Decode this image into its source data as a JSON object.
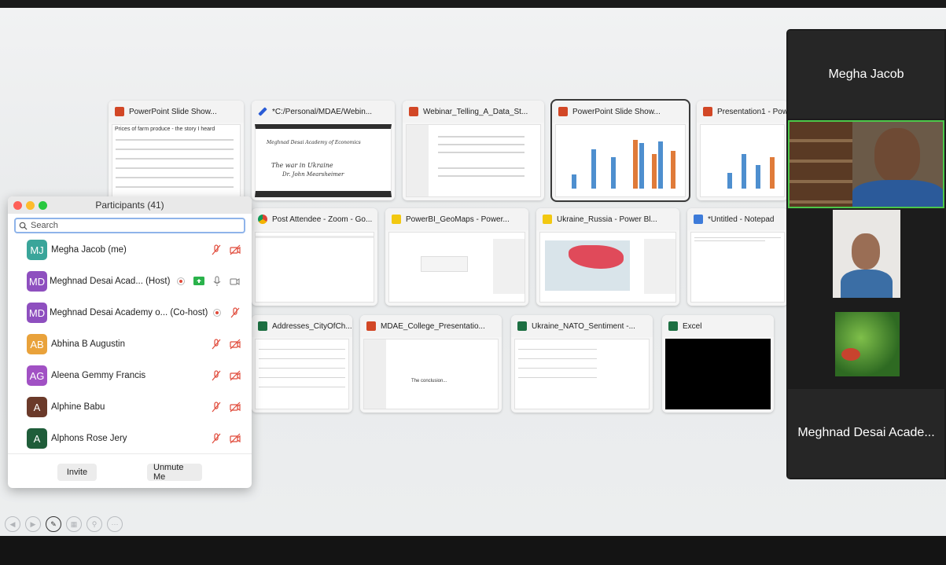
{
  "windows": [
    {
      "title": "PowerPoint Slide Show...",
      "icon": "powerpoint-icon",
      "subtitle": "Prices of farm produce - the story I heard"
    },
    {
      "title": "*C:/Personal/MDAE/Webin...",
      "icon": "pen-icon"
    },
    {
      "title": "Webinar_Telling_A_Data_St...",
      "icon": "powerpoint-icon"
    },
    {
      "title": "PowerPoint Slide Show...",
      "icon": "powerpoint-icon"
    },
    {
      "title": "Presentation1 - Pow",
      "icon": "powerpoint-icon"
    },
    {
      "title": "Post Attendee - Zoom - Go...",
      "icon": "chrome-icon"
    },
    {
      "title": "PowerBI_GeoMaps - Power...",
      "icon": "powerbi-icon"
    },
    {
      "title": "Ukraine_Russia - Power Bl...",
      "icon": "powerbi-icon"
    },
    {
      "title": "*Untitled - Notepad",
      "icon": "notepad-icon"
    },
    {
      "title": "Addresses_CityOfCh...",
      "icon": "excel-icon"
    },
    {
      "title": "MDAE_College_Presentatio...",
      "icon": "powerpoint-icon"
    },
    {
      "title": "Ukraine_NATO_Sentiment -...",
      "icon": "excel-icon"
    },
    {
      "title": "Excel",
      "icon": "excel-icon"
    }
  ],
  "participants": {
    "title": "Participants (41)",
    "search_placeholder": "Search",
    "rows": [
      {
        "initials": "MJ",
        "name": "Megha Jacob (me)",
        "color": "#3aa59a"
      },
      {
        "initials": "MD",
        "name": "Meghnad Desai Acad...  (Host)",
        "color": "#8e4fbf"
      },
      {
        "initials": "MD",
        "name": "Meghnad Desai Academy o...  (Co-host)",
        "color": "#8e4fbf"
      },
      {
        "initials": "AB",
        "name": "Abhina B Augustin",
        "color": "#e9a23b"
      },
      {
        "initials": "AG",
        "name": "Aleena Gemmy Francis",
        "color": "#a151c4"
      },
      {
        "initials": "A",
        "name": "Alphine Babu",
        "color": "#6b3a2a"
      },
      {
        "initials": "A",
        "name": "Alphons Rose Jery",
        "color": "#1f5d3a"
      }
    ],
    "invite_label": "Invite",
    "unmute_label": "Unmute Me"
  },
  "gallery": {
    "top_name": "Megha Jacob",
    "bottom_name": "Meghnad Desai Acade..."
  },
  "slide_text": {
    "handwriting_1": "Meghnad Desai Academy of Economics",
    "handwriting_2": "The war in Ukraine",
    "handwriting_3": "Dr. John Mearsheimer",
    "slide_center": "The conclusion..."
  }
}
